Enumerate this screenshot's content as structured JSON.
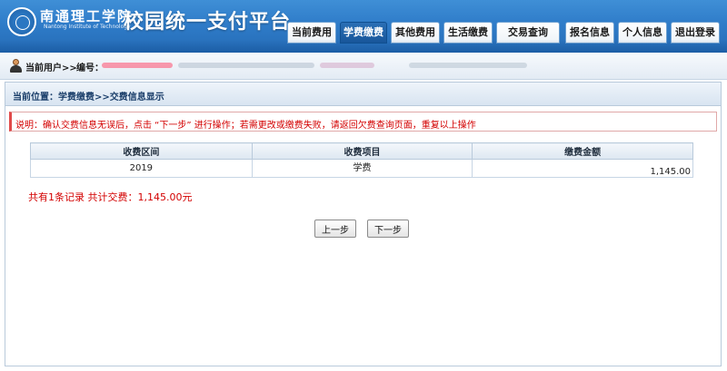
{
  "header": {
    "school_name": "南通理工学院",
    "school_name_en": "Nantong Institute of Technology",
    "platform_title": "校园统一支付平台",
    "nav": [
      {
        "label": "当前费用",
        "active": false
      },
      {
        "label": "学费缴费",
        "active": true
      },
      {
        "label": "其他费用",
        "active": false
      },
      {
        "label": "生活缴费",
        "active": false
      },
      {
        "label": "交易查询",
        "active": false
      },
      {
        "label": "报名信息",
        "active": false
      },
      {
        "label": "个人信息",
        "active": false
      },
      {
        "label": "退出登录",
        "active": false
      }
    ]
  },
  "userbar": {
    "current_user_label": "当前用户>>",
    "id_label": "编号："
  },
  "breadcrumb": "当前位置：学费缴费>>交费信息显示",
  "notice": "说明：确认交费信息无误后，点击 “下一步” 进行操作；若需更改或缴费失败，请返回欠费查询页面，重复以上操作",
  "table": {
    "headers": [
      "收费区间",
      "收费项目",
      "缴费金额"
    ],
    "rows": [
      {
        "period": "2019",
        "item": "学费",
        "amount": "1,145.00"
      }
    ]
  },
  "summary": "共有1条记录  共计交费：1,145.00元",
  "buttons": {
    "prev": "上一步",
    "next": "下一步"
  },
  "colors": {
    "header_blue": "#2f7cc9",
    "active_tab": "#18569a",
    "alert_red": "#d30000"
  }
}
